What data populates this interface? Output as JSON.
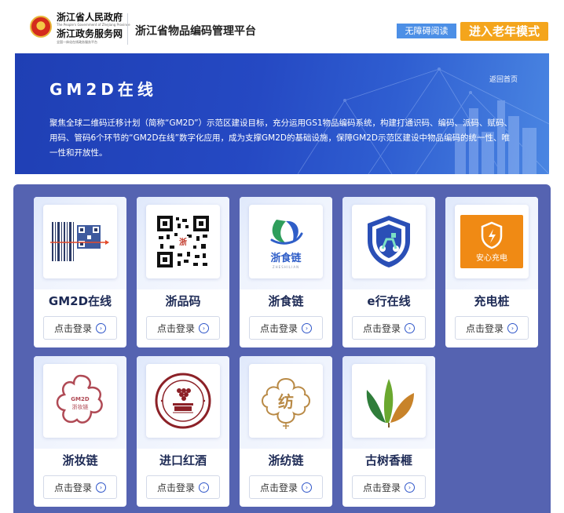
{
  "header": {
    "gov_name": "浙江省人民政府",
    "gov_en": "The People's Government of Zhejiang Province",
    "gov_service": "浙江政务服务网",
    "gov_sub": "全国一体化在线政务服务平台",
    "platform_title": "浙江省物品编码管理平台",
    "accessible_label": "无障碍阅读",
    "elder_mode_label": "进入老年模式"
  },
  "banner": {
    "title": "GM2D在线",
    "back_link": "返回首页",
    "description": "聚焦全球二维码迁移计划（简称“GM2D”）示范区建设目标，充分运用GS1物品编码系统，构建打通识码、编码、派码、赋码、用码、管码6个环节的“GM2D在线”数字化应用，成为支撑GM2D的基础设施，保障GM2D示范区建设中物品编码的统一性、唯一性和开放性。"
  },
  "cards": [
    {
      "name": "GM2D在线",
      "button": "点击登录",
      "icon": "barcode-qr-icon"
    },
    {
      "name": "浙品码",
      "button": "点击登录",
      "icon": "qr-code-icon"
    },
    {
      "name": "浙食链",
      "button": "点击登录",
      "icon": "zhe-shi-lian-logo",
      "logo_text": "浙食链",
      "logo_sub": "ZHESHILIAN"
    },
    {
      "name": "e行在线",
      "button": "点击登录",
      "icon": "shield-scooter-icon"
    },
    {
      "name": "充电桩",
      "button": "点击登录",
      "icon": "charging-shield-icon",
      "logo_text": "安心充电"
    },
    {
      "name": "浙妆链",
      "button": "点击登录",
      "icon": "zhe-zhuang-lian-logo",
      "logo_text": "GM2D",
      "logo_sub": "浙妆链"
    },
    {
      "name": "进口红酒",
      "button": "点击登录",
      "icon": "wine-seal-icon"
    },
    {
      "name": "浙纺链",
      "button": "点击登录",
      "icon": "fang-flower-icon",
      "logo_text": "纺"
    },
    {
      "name": "古树香榧",
      "button": "点击登录",
      "icon": "leaves-logo-icon"
    }
  ],
  "colors": {
    "banner": "#2549c3",
    "panel": "#5563b1",
    "accessible": "#4c8fe6",
    "elder": "#f4a51c",
    "charge_orange": "#f08a14"
  }
}
